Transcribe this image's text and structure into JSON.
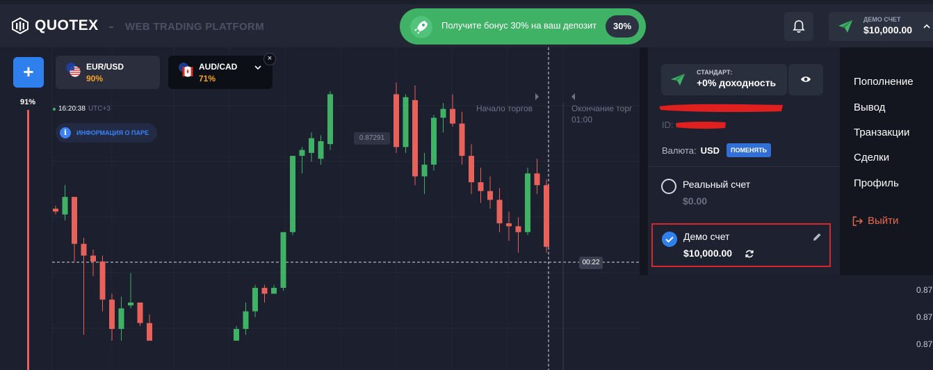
{
  "header": {
    "logo_text": "QUOTEX",
    "platform_label": "WEB TRADING PLATFORM",
    "promo_text": "Получите бонус 30% на ваш депозит",
    "promo_badge": "30%",
    "account_label": "ДЕМО СЧЕТ",
    "account_balance": "$10,000.00"
  },
  "left_panel": {
    "add_symbol": "+",
    "payout_level": "91%"
  },
  "pair_tabs": [
    {
      "name": "EUR/USD",
      "payout": "90%"
    },
    {
      "name": "AUD/CAD",
      "payout": "71%"
    }
  ],
  "close_symbol": "×",
  "chart": {
    "time": "16:20:38",
    "timezone": "UTC+3",
    "info_button": "ИНФОРМАЦИЯ О ПАРЕ",
    "start_label": "Начало торгов",
    "end_label": "Окончание торг",
    "end_time": "01:00",
    "price_flag": "0.87291",
    "timer": "00:22",
    "axis_values": [
      "0.87",
      "0.87",
      "0.87"
    ],
    "colors": {
      "up": "#3fb266",
      "down": "#e8625c"
    }
  },
  "chart_data": {
    "type": "candlestick",
    "candles": [
      {
        "o": 0.87245,
        "h": 0.87246,
        "l": 0.87243,
        "c": 0.87244
      },
      {
        "o": 0.87243,
        "h": 0.87253,
        "l": 0.87241,
        "c": 0.87249
      },
      {
        "o": 0.87249,
        "h": 0.87249,
        "l": 0.87227,
        "c": 0.87233
      },
      {
        "o": 0.87233,
        "h": 0.87235,
        "l": 0.87202,
        "c": 0.87229
      },
      {
        "o": 0.87229,
        "h": 0.87231,
        "l": 0.87222,
        "c": 0.87227
      },
      {
        "o": 0.87227,
        "h": 0.87229,
        "l": 0.8721,
        "c": 0.87214
      },
      {
        "o": 0.87214,
        "h": 0.87216,
        "l": 0.872,
        "c": 0.87204
      },
      {
        "o": 0.87204,
        "h": 0.87215,
        "l": 0.872,
        "c": 0.87211
      },
      {
        "o": 0.87212,
        "h": 0.87223,
        "l": 0.87211,
        "c": 0.87213
      },
      {
        "o": 0.87213,
        "h": 0.87213,
        "l": 0.87205,
        "c": 0.87206
      },
      {
        "o": 0.87206,
        "h": 0.87209,
        "l": 0.872,
        "c": 0.872
      }
    ],
    "candles_right": [
      {
        "o": 0.872,
        "h": 0.87205,
        "l": 0.872,
        "c": 0.87204
      },
      {
        "o": 0.87204,
        "h": 0.87213,
        "l": 0.87202,
        "c": 0.8721
      },
      {
        "o": 0.8721,
        "h": 0.87219,
        "l": 0.87208,
        "c": 0.87218
      },
      {
        "o": 0.87218,
        "h": 0.87219,
        "l": 0.87213,
        "c": 0.87216
      },
      {
        "o": 0.87216,
        "h": 0.87219,
        "l": 0.87216,
        "c": 0.87218
      },
      {
        "o": 0.87218,
        "h": 0.87237,
        "l": 0.87217,
        "c": 0.87237
      },
      {
        "o": 0.87237,
        "h": 0.87263,
        "l": 0.87236,
        "c": 0.87263
      },
      {
        "o": 0.87263,
        "h": 0.87266,
        "l": 0.87257,
        "c": 0.87265
      },
      {
        "o": 0.87264,
        "h": 0.87271,
        "l": 0.87261,
        "c": 0.87269
      },
      {
        "o": 0.87262,
        "h": 0.8727,
        "l": 0.8726,
        "c": 0.87268
      },
      {
        "o": 0.87267,
        "h": 0.87285,
        "l": 0.87265,
        "c": 0.87284
      }
    ],
    "ylim": [
      0.8719,
      0.873
    ]
  },
  "dropdown": {
    "tier_label": "СТАНДАРТ:",
    "tier_yield": "+0% доходность",
    "id_label": "ID:",
    "currency_label": "Валюта:",
    "currency_value": "USD",
    "change_button": "ПОМЕНЯТЬ",
    "accounts": [
      {
        "name": "Реальный счет",
        "balance": "$0.00",
        "selected": false
      },
      {
        "name": "Демо счет",
        "balance": "$10,000.00",
        "selected": true
      }
    ],
    "menu": [
      "Пополнение",
      "Вывод",
      "Транзакции",
      "Сделки",
      "Профиль"
    ],
    "logout": "Выйти"
  }
}
